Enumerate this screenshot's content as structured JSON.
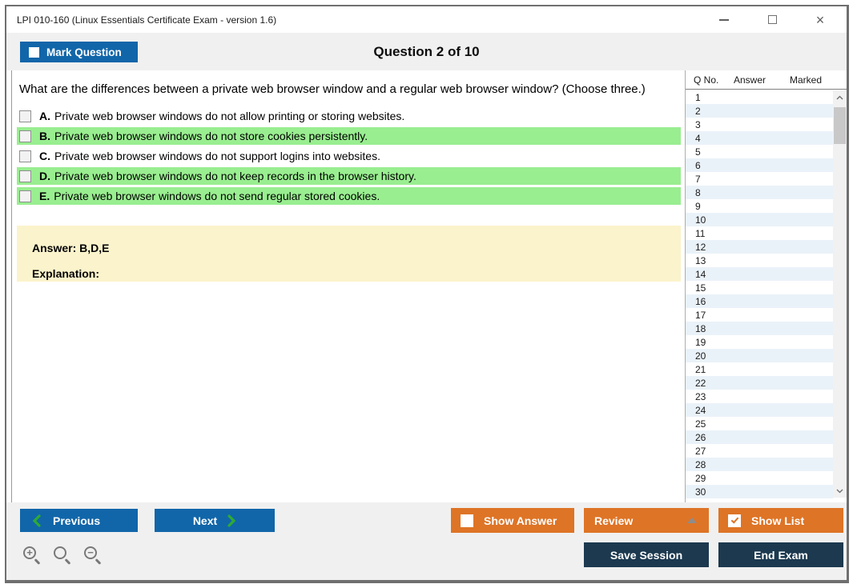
{
  "window": {
    "title": "LPI 010-160 (Linux Essentials Certificate Exam - version 1.6)"
  },
  "header": {
    "mark_question_label": "Mark Question",
    "question_counter": "Question 2 of 10"
  },
  "question": {
    "text": "What are the differences between a private web browser window and a regular web browser window? (Choose three.)"
  },
  "options": [
    {
      "letter": "A.",
      "text": "Private web browser windows do not allow printing or storing websites.",
      "highlighted": false,
      "checked": false
    },
    {
      "letter": "B.",
      "text": "Private web browser windows do not store cookies persistently.",
      "highlighted": true,
      "checked": false
    },
    {
      "letter": "C.",
      "text": "Private web browser windows do not support logins into websites.",
      "highlighted": false,
      "checked": false
    },
    {
      "letter": "D.",
      "text": "Private web browser windows do not keep records in the browser history.",
      "highlighted": true,
      "checked": false
    },
    {
      "letter": "E.",
      "text": "Private web browser windows do not send regular stored cookies.",
      "highlighted": true,
      "checked": false
    }
  ],
  "answer_panel": {
    "answer_label": "Answer: B,D,E",
    "explanation_label": "Explanation:"
  },
  "question_list": {
    "columns": [
      "Q No.",
      "Answer",
      "Marked"
    ],
    "visible_rows": [
      {
        "q": "1",
        "answer": "",
        "marked": ""
      },
      {
        "q": "2",
        "answer": "",
        "marked": ""
      },
      {
        "q": "3",
        "answer": "",
        "marked": ""
      },
      {
        "q": "4",
        "answer": "",
        "marked": ""
      },
      {
        "q": "5",
        "answer": "",
        "marked": ""
      },
      {
        "q": "6",
        "answer": "",
        "marked": ""
      },
      {
        "q": "7",
        "answer": "",
        "marked": ""
      },
      {
        "q": "8",
        "answer": "",
        "marked": ""
      },
      {
        "q": "9",
        "answer": "",
        "marked": ""
      },
      {
        "q": "10",
        "answer": "",
        "marked": ""
      },
      {
        "q": "11",
        "answer": "",
        "marked": ""
      },
      {
        "q": "12",
        "answer": "",
        "marked": ""
      },
      {
        "q": "13",
        "answer": "",
        "marked": ""
      },
      {
        "q": "14",
        "answer": "",
        "marked": ""
      },
      {
        "q": "15",
        "answer": "",
        "marked": ""
      },
      {
        "q": "16",
        "answer": "",
        "marked": ""
      },
      {
        "q": "17",
        "answer": "",
        "marked": ""
      },
      {
        "q": "18",
        "answer": "",
        "marked": ""
      },
      {
        "q": "19",
        "answer": "",
        "marked": ""
      },
      {
        "q": "20",
        "answer": "",
        "marked": ""
      },
      {
        "q": "21",
        "answer": "",
        "marked": ""
      },
      {
        "q": "22",
        "answer": "",
        "marked": ""
      },
      {
        "q": "23",
        "answer": "",
        "marked": ""
      },
      {
        "q": "24",
        "answer": "",
        "marked": ""
      },
      {
        "q": "25",
        "answer": "",
        "marked": ""
      },
      {
        "q": "26",
        "answer": "",
        "marked": ""
      },
      {
        "q": "27",
        "answer": "",
        "marked": ""
      },
      {
        "q": "28",
        "answer": "",
        "marked": ""
      },
      {
        "q": "29",
        "answer": "",
        "marked": ""
      },
      {
        "q": "30",
        "answer": "",
        "marked": ""
      }
    ]
  },
  "footer": {
    "previous_label": "Previous",
    "next_label": "Next",
    "show_answer_label": "Show Answer",
    "show_answer_checked": false,
    "review_label": "Review",
    "show_list_label": "Show List",
    "show_list_checked": true,
    "save_session_label": "Save Session",
    "end_exam_label": "End Exam"
  },
  "icons": {
    "close_glyph": "×",
    "zoom_in_glyph": "+",
    "zoom_out_glyph": "−"
  },
  "colors": {
    "accent_blue": "#1166a9",
    "accent_orange": "#de7426",
    "dark_navy": "#1c394f",
    "highlight_green": "#99ee90",
    "answer_yellow": "#fbf3cb",
    "alt_row_blue": "#eaf2f9",
    "chevron_green": "#2faa35"
  }
}
